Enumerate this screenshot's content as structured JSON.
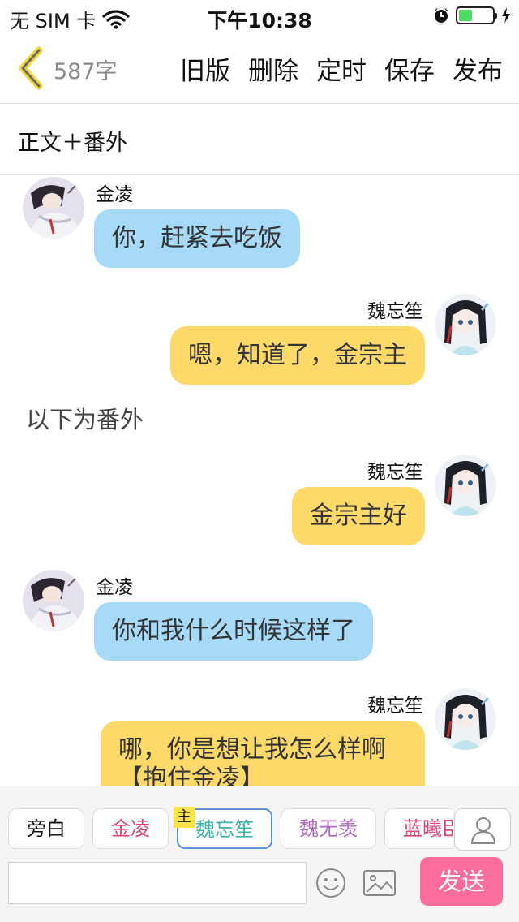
{
  "status_bar": {
    "carrier": "无 SIM 卡",
    "time": "下午10:38",
    "battery_level": 0.4,
    "battery_color": "#4cd964"
  },
  "nav": {
    "back_icon": "chevron-left-icon",
    "word_count": "587字",
    "actions": [
      "旧版",
      "删除",
      "定时",
      "保存",
      "发布"
    ]
  },
  "chapter_title": "正文＋番外",
  "messages": [
    {
      "side": "left",
      "name": "金凌",
      "text": "你，赶紧去吃饭"
    },
    {
      "side": "right",
      "name": "魏忘笙",
      "text": "嗯，知道了，金宗主"
    },
    {
      "type": "narration",
      "text": "以下为番外"
    },
    {
      "side": "right",
      "name": "魏忘笙",
      "text": "金宗主好"
    },
    {
      "side": "left",
      "name": "金凌",
      "text": "你和我什么时候这样了"
    },
    {
      "side": "right",
      "name": "魏忘笙",
      "text": "哪，你是想让我怎么样啊【抱住金凌】"
    }
  ],
  "characters": {
    "narrator": "旁白",
    "chips": [
      {
        "label": "金凌",
        "color": "#e0457b"
      },
      {
        "label": "魏忘笙",
        "color": "#3bb3a8"
      },
      {
        "label": "魏无羡",
        "color": "#b068c8"
      },
      {
        "label": "蓝曦臣",
        "color": "#e0457b"
      }
    ],
    "main_badge": "主",
    "active_border": "#5a93d8"
  },
  "composer": {
    "input_value": "",
    "send_label": "发送",
    "send_color": "#fb6e9c",
    "emoji_icon": "smiley-icon",
    "image_icon": "image-icon",
    "person_icon": "person-icon"
  }
}
